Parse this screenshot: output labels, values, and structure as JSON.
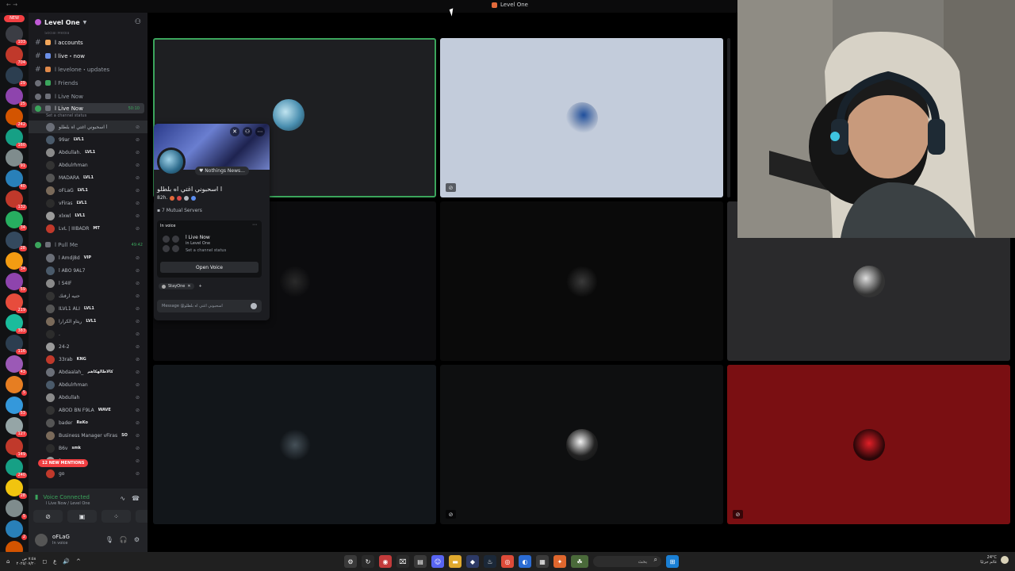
{
  "window": {
    "title": "Level One"
  },
  "rail": {
    "top_pill": "NEW",
    "badges": [
      "103",
      "704",
      "29",
      "25",
      "242",
      "160",
      "91",
      "40",
      "132",
      "34",
      "28",
      "34",
      "59",
      "219",
      "383",
      "116",
      "43",
      "5",
      "53",
      "127",
      "149",
      "240",
      "28",
      "5",
      "2",
      "36"
    ],
    "bottom_pill": "NEW"
  },
  "server": {
    "name": "Level One"
  },
  "channels": {
    "faded_label": "Social Media",
    "items": [
      {
        "label": "l accounts",
        "kind": "text"
      },
      {
        "label": "l live・now",
        "kind": "text"
      },
      {
        "label": "l levelone・updates",
        "kind": "text"
      },
      {
        "label": "l Friends",
        "kind": "voice"
      },
      {
        "label": "l Live Now",
        "kind": "voice"
      }
    ],
    "active_voice": {
      "label": "l Live Now",
      "timer": "50:10",
      "status": "Set a channel status"
    }
  },
  "voice_users_1": [
    {
      "name": "اسحبوني اغتي اه بلطلو l",
      "tag": ""
    },
    {
      "name": "99ar",
      "tag": "LVL1"
    },
    {
      "name": "Abdullah.",
      "tag": "LVL1"
    },
    {
      "name": "Abdulrhman",
      "tag": ""
    },
    {
      "name": "MADARA",
      "tag": "LVL1"
    },
    {
      "name": "oFLaG",
      "tag": "LVL1"
    },
    {
      "name": "vFiras",
      "tag": "LVL1"
    },
    {
      "name": "xlxwl",
      "tag": "LVL1"
    },
    {
      "name": "LvL | IIIBADR",
      "tag": "MT"
    }
  ],
  "channel2": {
    "label": "l Pull Me",
    "timer": "49:42"
  },
  "voice_users_2": [
    {
      "name": "l Amdj8d",
      "tag": "VIP"
    },
    {
      "name": "l ABO 9AL7",
      "tag": ""
    },
    {
      "name": "l S4IF",
      "tag": ""
    },
    {
      "name": "حنيه ارفنك",
      "tag": ""
    },
    {
      "name": "ILVL1 ALI",
      "tag": "LVL1"
    },
    {
      "name": "ريتاو الكرارا",
      "tag": "LVL1"
    },
    {
      "name": ".",
      "tag": ""
    },
    {
      "name": "24-2",
      "tag": ""
    },
    {
      "name": "33rab",
      "tag": "KNG"
    },
    {
      "name": "Abdaalah_",
      "tag": "كالاظالهكاهم"
    },
    {
      "name": "Abdulrhman",
      "tag": ""
    },
    {
      "name": "Abdullah",
      "tag": ""
    },
    {
      "name": "ABOD BN F9LA",
      "tag": "WAVE"
    },
    {
      "name": "bader",
      "tag": "ReKo"
    },
    {
      "name": "Business Manager vFiras",
      "tag": "SO"
    },
    {
      "name": "B6v",
      "tag": "smk"
    },
    {
      "name": "fazaa",
      "tag": ""
    },
    {
      "name": "go",
      "tag": ""
    }
  ],
  "mentions": "12 NEW MENTIONS",
  "voice_panel": {
    "status": "Voice Connected",
    "location": "l Live Now / Level One"
  },
  "user_panel": {
    "name": "oFLaG",
    "status": "In voice"
  },
  "popout": {
    "status_bubble": "Nothings News...",
    "display_name": "اسحبوني اغتي اه بلطلو l",
    "username": "82h.",
    "mutual": "7 Mutual Servers",
    "in_voice_label": "In voice",
    "channel": "l Live Now",
    "server": "in Level One",
    "channel_status": "Set a channel status",
    "open_voice": "Open Voice",
    "guild_tag": "StayOne",
    "message_placeholder": "Message @اسحبوني اغتي اه بلطلو"
  },
  "taskbar": {
    "time": "٧:٥٨ ص",
    "date": "٢٠٢٥/٠٧/٢٠",
    "lang": "ع",
    "search_placeholder": "بحث",
    "weather_temp": "24°C",
    "weather_desc": "غائم جزئيًا"
  }
}
